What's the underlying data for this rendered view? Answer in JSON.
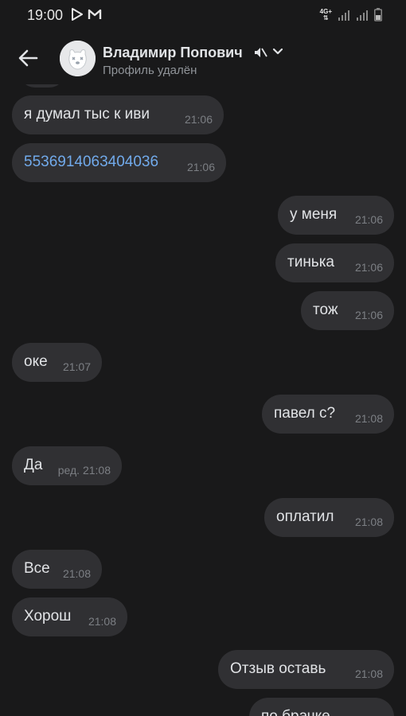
{
  "status_bar": {
    "time": "19:00",
    "network": "4G+",
    "icons": [
      "play-store-icon",
      "gmail-icon",
      "signal-icon",
      "battery-icon"
    ]
  },
  "header": {
    "name": "Владимир Попович",
    "status": "Профиль удалён",
    "muted": true
  },
  "messages": [
    {
      "direction": "in",
      "text": "я думал тыс к иви",
      "time": "21:06"
    },
    {
      "direction": "in",
      "text": "5536914063404036",
      "time": "21:06",
      "link": true
    },
    {
      "direction": "out",
      "text": "у меня",
      "time": "21:06"
    },
    {
      "direction": "out",
      "text": "тинька",
      "time": "21:06"
    },
    {
      "direction": "out",
      "text": "тож",
      "time": "21:06"
    },
    {
      "direction": "in",
      "text": "оке",
      "time": "21:07"
    },
    {
      "direction": "out",
      "text": "павел с?",
      "time": "21:08"
    },
    {
      "direction": "in",
      "text": "Да",
      "time": "ред. 21:08"
    },
    {
      "direction": "out",
      "text": "оплатил",
      "time": "21:08"
    },
    {
      "direction": "in",
      "text": "Все",
      "time": "21:08"
    },
    {
      "direction": "in",
      "text": "Хорош",
      "time": "21:08"
    },
    {
      "direction": "out",
      "text": "Отзыв оставь",
      "time": "21:08"
    },
    {
      "direction": "out",
      "text": "по брачке",
      "time": ""
    }
  ],
  "colors": {
    "background": "#19191a",
    "bubble": "#303033",
    "text": "#e1e3e6",
    "time": "#7c7f84",
    "link": "#71aaeb",
    "status_text": "#909499"
  }
}
